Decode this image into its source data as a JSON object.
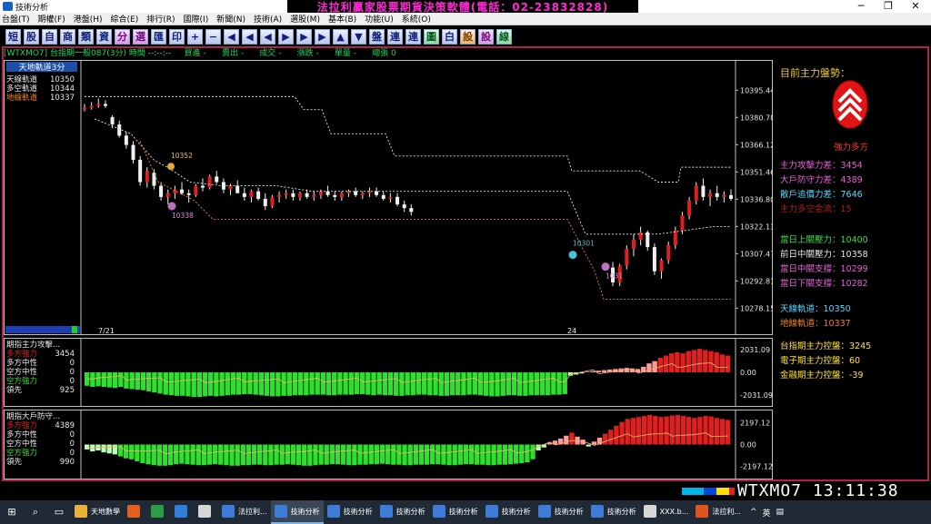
{
  "window": {
    "title": "技術分析",
    "banner": "法拉利贏家股票期貨決策軟體(電話：02-23832828)",
    "controls": [
      "─",
      "❐",
      "✕"
    ]
  },
  "menu": [
    "台盤(T)",
    "期權(F)",
    "港盤(H)",
    "綜合(E)",
    "排行(R)",
    "國際(I)",
    "新聞(N)",
    "技術(A)",
    "選股(M)",
    "基本(B)",
    "功能(U)",
    "系統(O)"
  ],
  "toolbar": [
    "短",
    "股",
    "自",
    "商",
    "類",
    "資",
    "分",
    "選",
    "匯",
    "印",
    "+",
    "−",
    "◀",
    "◀",
    "◀",
    "▶",
    "▶",
    "▶",
    "▲",
    "▼",
    "盤",
    "連",
    "連",
    "圖",
    "白",
    "設",
    "設",
    "線"
  ],
  "infobar": {
    "symbol": "[WTXMO7]",
    "name": "台指期一般087(3分)",
    "time_label": "時間",
    "time_value": "--:--:--",
    "buy_label": "買進",
    "buy_value": "-",
    "sell_label": "賣出",
    "sell_value": "-",
    "trade_label": "成交",
    "trade_value": "-",
    "change_label": "漲跌",
    "change_value": "-",
    "vol_label": "單量",
    "vol_value": "-",
    "total_label": "總張",
    "total_value": "0"
  },
  "chart_data": [
    {
      "type": "candlestick",
      "title": "天地軌道3分",
      "legend": [
        {
          "label": "天線軌道",
          "value": "10350",
          "color": "#e8e8e8"
        },
        {
          "label": "多空軌道",
          "value": "10344",
          "color": "#e8e8e8"
        },
        {
          "label": "地線軌道",
          "value": "10337",
          "color": "#f08030"
        }
      ],
      "y_ticks": [
        "10395.44",
        "10380.78",
        "10366.12",
        "10351.46",
        "10336.80",
        "10322.13",
        "10307.47",
        "10292.81",
        "10278.15"
      ],
      "ylim": [
        10270,
        10400
      ],
      "x_labels": [
        "7/21",
        "24"
      ],
      "annotations": [
        {
          "text": "10352",
          "color": "#e8c83a"
        },
        {
          "text": "10338",
          "color": "#d88ad8"
        },
        {
          "text": "10301",
          "color": "#49c2d6"
        },
        {
          "text": "1031",
          "color": "#d88ad8"
        }
      ],
      "ohlc": [
        [
          10385,
          10388,
          10384,
          10386
        ],
        [
          10386,
          10389,
          10385,
          10387
        ],
        [
          10387,
          10391,
          10386,
          10388
        ],
        [
          10388,
          10390,
          10386,
          10387
        ],
        [
          10381,
          10382,
          10375,
          10377
        ],
        [
          10377,
          10379,
          10370,
          10371
        ],
        [
          10371,
          10373,
          10364,
          10366
        ],
        [
          10366,
          10368,
          10356,
          10358
        ],
        [
          10358,
          10360,
          10344,
          10346
        ],
        [
          10346,
          10354,
          10343,
          10352
        ],
        [
          10351,
          10353,
          10342,
          10344
        ],
        [
          10344,
          10346,
          10336,
          10338
        ],
        [
          10338,
          10342,
          10334,
          10340
        ],
        [
          10340,
          10344,
          10337,
          10342
        ],
        [
          10342,
          10346,
          10339,
          10340
        ],
        [
          10340,
          10342,
          10335,
          10339
        ],
        [
          10339,
          10345,
          10338,
          10344
        ],
        [
          10344,
          10348,
          10341,
          10343
        ],
        [
          10343,
          10350,
          10342,
          10349
        ],
        [
          10349,
          10352,
          10345,
          10346
        ],
        [
          10346,
          10348,
          10340,
          10342
        ],
        [
          10342,
          10345,
          10339,
          10344
        ],
        [
          10344,
          10347,
          10341,
          10340
        ],
        [
          10340,
          10343,
          10336,
          10338
        ],
        [
          10338,
          10342,
          10335,
          10341
        ],
        [
          10341,
          10343,
          10336,
          10337
        ],
        [
          10337,
          10340,
          10331,
          10333
        ],
        [
          10333,
          10339,
          10332,
          10338
        ],
        [
          10338,
          10341,
          10335,
          10339
        ],
        [
          10339,
          10342,
          10337,
          10340
        ],
        [
          10340,
          10342,
          10336,
          10338
        ],
        [
          10338,
          10341,
          10336,
          10340
        ],
        [
          10340,
          10342,
          10337,
          10338
        ],
        [
          10338,
          10341,
          10336,
          10339
        ],
        [
          10339,
          10342,
          10337,
          10341
        ],
        [
          10341,
          10344,
          10338,
          10339
        ],
        [
          10339,
          10341,
          10336,
          10338
        ],
        [
          10338,
          10341,
          10336,
          10340
        ],
        [
          10340,
          10342,
          10338,
          10341
        ],
        [
          10341,
          10343,
          10338,
          10339
        ],
        [
          10339,
          10341,
          10337,
          10340
        ],
        [
          10340,
          10343,
          10338,
          10341
        ],
        [
          10341,
          10343,
          10338,
          10339
        ],
        [
          10339,
          10341,
          10336,
          10337
        ],
        [
          10337,
          10340,
          10335,
          10338
        ],
        [
          10338,
          10340,
          10333,
          10334
        ],
        [
          10334,
          10336,
          10330,
          10332
        ],
        [
          10332,
          10334,
          10328,
          10330
        ],
        [
          10300,
          10303,
          10290,
          10292
        ],
        [
          10292,
          10302,
          10290,
          10301
        ],
        [
          10301,
          10312,
          10299,
          10310
        ],
        [
          10310,
          10318,
          10306,
          10315
        ],
        [
          10315,
          10322,
          10312,
          10319
        ],
        [
          10319,
          10320,
          10309,
          10311
        ],
        [
          10311,
          10313,
          10296,
          10298
        ],
        [
          10298,
          10305,
          10294,
          10304
        ],
        [
          10304,
          10314,
          10302,
          10312
        ],
        [
          10312,
          10322,
          10310,
          10320
        ],
        [
          10320,
          10330,
          10318,
          10328
        ],
        [
          10328,
          10338,
          10326,
          10336
        ],
        [
          10336,
          10346,
          10334,
          10344
        ],
        [
          10344,
          10348,
          10336,
          10338
        ],
        [
          10338,
          10342,
          10333,
          10340
        ],
        [
          10340,
          10344,
          10336,
          10338
        ],
        [
          10338,
          10341,
          10335,
          10339
        ],
        [
          10339,
          10342,
          10336,
          10337
        ]
      ]
    },
    {
      "type": "bar",
      "title": "期指主力攻擊",
      "legend": [
        {
          "label": "多方強力",
          "value": "3454",
          "color": "#e21f1f"
        },
        {
          "label": "多方中性",
          "value": "0",
          "color": "#e8e8e8"
        },
        {
          "label": "空方中性",
          "value": "0",
          "color": "#e8e8e8"
        },
        {
          "label": "空方強力",
          "value": "0",
          "color": "#2ee02e"
        },
        {
          "label": "領先",
          "value": "925",
          "color": "#e8e8e8"
        }
      ],
      "y_ticks": [
        "2031.09",
        "0.00",
        "-2031.09"
      ],
      "ylim": [
        -2600,
        2600
      ],
      "values": [
        -1200,
        -1300,
        -1250,
        -1300,
        -1350,
        -1400,
        -1300,
        -1450,
        -1500,
        -1550,
        -1600,
        -1700,
        -1800,
        -1900,
        -2000,
        -2050,
        -2100,
        -2100,
        -2150,
        -2200,
        -2200,
        -2150,
        -2100,
        -2150,
        -2100,
        -2050,
        -2000,
        -2000,
        -1950,
        -1950,
        -2000,
        -2050,
        -2100,
        -2150,
        -2150,
        -2100,
        -2100,
        -2050,
        -2050,
        -2050,
        -2000,
        -2000,
        -2000,
        -2050,
        -2050,
        -2000,
        -2000,
        -2000,
        -1950,
        -1950,
        -2000,
        -2050,
        -2000,
        -2050,
        -2050,
        -2100,
        -2100,
        -2050,
        -2050,
        -2000,
        -2000,
        -2050,
        -2050,
        -2100,
        -2100,
        -2050,
        -2050,
        -2050,
        -2000,
        -2000,
        -2050,
        -2100,
        -2150,
        -2150,
        -2100,
        -2050,
        -2050,
        -2100,
        -2100,
        -2050,
        -2050,
        -2050,
        -2050,
        -2000,
        -2000,
        -1950,
        -300,
        -200,
        -100,
        50,
        100,
        150,
        200,
        250,
        300,
        350,
        400,
        350,
        300,
        500,
        800,
        1000,
        1300,
        1500,
        1700,
        1800,
        1700,
        1900,
        2000,
        2100,
        2000,
        1900,
        1800,
        1600,
        1500
      ]
    },
    {
      "type": "bar",
      "title": "期指大戶防守",
      "legend": [
        {
          "label": "多方強力",
          "value": "4389",
          "color": "#e21f1f"
        },
        {
          "label": "多方中性",
          "value": "0",
          "color": "#e8e8e8"
        },
        {
          "label": "空方中性",
          "value": "0",
          "color": "#e8e8e8"
        },
        {
          "label": "空方強力",
          "value": "0",
          "color": "#2ee02e"
        },
        {
          "label": "領先",
          "value": "990",
          "color": "#e8e8e8"
        }
      ],
      "y_ticks": [
        "2197.12",
        "0.00",
        "-2197.12"
      ],
      "ylim": [
        -3000,
        3000
      ],
      "values": [
        -500,
        -700,
        -600,
        -800,
        -900,
        -1000,
        -1200,
        -1400,
        -1500,
        -1700,
        -1900,
        -2000,
        -2100,
        -2150,
        -2150,
        -2100,
        -2000,
        -1950,
        -2000,
        -2050,
        -2100,
        -2100,
        -2050,
        -2000,
        -2050,
        -2100,
        -2150,
        -2150,
        -2100,
        -2100,
        -2050,
        -2050,
        -2100,
        -2100,
        -2050,
        -2050,
        -2000,
        -2050,
        -2100,
        -2150,
        -2150,
        -2100,
        -2050,
        -2050,
        -2000,
        -2000,
        -2050,
        -2100,
        -2100,
        -2050,
        -2050,
        -2000,
        -2000,
        -1950,
        -2000,
        -2050,
        -2050,
        -2100,
        -2100,
        -2050,
        -2050,
        -2050,
        -2000,
        -2000,
        -2050,
        -2100,
        -2100,
        -2050,
        -2000,
        -2000,
        -2050,
        -2050,
        -2100,
        -2100,
        -2050,
        -2050,
        -2000,
        -1950,
        -1900,
        -1800,
        -1500,
        -600,
        -300,
        200,
        400,
        600,
        900,
        1200,
        800,
        500,
        -200,
        300,
        700,
        1100,
        1500,
        1900,
        2300,
        2600,
        2700,
        2800,
        2900,
        3000,
        2900,
        2800,
        2850,
        2950,
        3000,
        2900,
        2800,
        2700,
        2800,
        2900,
        2850,
        2700,
        2600,
        2500
      ]
    }
  ],
  "right_panel": {
    "header": "目前主力盤勢：",
    "signal": "強力多方",
    "metrics": [
      {
        "label": "主力攻擊力差",
        "value": "3454",
        "color": "#e860d8"
      },
      {
        "label": "大戶防守力差",
        "value": "4389",
        "color": "#e860d8"
      },
      {
        "label": "散戶追價力差",
        "value": "7646",
        "color": "#5ad8ff"
      },
      {
        "label": "主力多空金流",
        "value": "15",
        "color": "#b02020"
      }
    ],
    "levels": [
      {
        "label": "當日上關壓力",
        "value": "10400",
        "color": "#38e038"
      },
      {
        "label": "前日中關壓力",
        "value": "10358",
        "color": "#e8e8e8"
      },
      {
        "label": "當日中關支撐",
        "value": "10299",
        "color": "#e860d8"
      },
      {
        "label": "當日下關支撐",
        "value": "10282",
        "color": "#e860d8"
      }
    ],
    "bands": [
      {
        "label": "天線軌道",
        "value": "10350",
        "color": "#5ad8ff"
      },
      {
        "label": "地線軌道",
        "value": "10337",
        "color": "#f08030"
      }
    ],
    "control": [
      {
        "label": "台指期主力控盤",
        "value": "3245",
        "color": "#ffe040"
      },
      {
        "label": "電子期主力控盤",
        "value": "60",
        "color": "#ffe040"
      },
      {
        "label": "金融期主力控盤",
        "value": "-39",
        "color": "#ffe040"
      }
    ]
  },
  "status": {
    "symbol": "WTXMO7",
    "clock": "13:11:38"
  },
  "taskbar": {
    "apps": [
      {
        "label": "天地數學",
        "color": "#e8b23c"
      },
      {
        "label": "",
        "color": "#e06020"
      },
      {
        "label": "",
        "color": "#2e9c44"
      },
      {
        "label": "",
        "color": "#2f7fd9"
      },
      {
        "label": "",
        "color": "#d7d7d7"
      },
      {
        "label": "法拉利...",
        "color": "#3e7bd6"
      },
      {
        "label": "技術分析",
        "color": "#3e7bd6"
      },
      {
        "label": "技術分析",
        "color": "#3e7bd6"
      },
      {
        "label": "技術分析",
        "color": "#3e7bd6"
      },
      {
        "label": "技術分析",
        "color": "#3e7bd6"
      },
      {
        "label": "技術分析",
        "color": "#3e7bd6"
      },
      {
        "label": "技術分析",
        "color": "#3e7bd6"
      },
      {
        "label": "技術分析",
        "color": "#3e7bd6"
      },
      {
        "label": "XXX.b...",
        "color": "#d7d7d7"
      },
      {
        "label": "法拉利...",
        "color": "#e2521e"
      }
    ],
    "tray_ime": "英"
  }
}
